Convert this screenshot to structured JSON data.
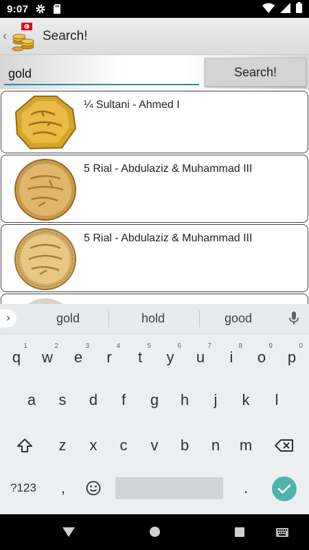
{
  "status_bar": {
    "time": "9:07",
    "icons": [
      "gear-icon",
      "sd-card-icon",
      "wifi-icon",
      "signal-icon",
      "battery-icon"
    ]
  },
  "action_bar": {
    "title": "Search!",
    "flag_color": "#e70013"
  },
  "search": {
    "query": "gold",
    "button_label": "Search!"
  },
  "results": [
    {
      "title": "¼ Sultani - Ahmed I",
      "coin": "octagonal"
    },
    {
      "title": "5 Rial - Abdulaziz & Muhammad III",
      "coin": "round"
    },
    {
      "title": "5 Rial - Abdulaziz & Muhammad III",
      "coin": "round"
    },
    {
      "title": "",
      "coin": "round-partial"
    }
  ],
  "keyboard": {
    "suggestions": [
      "gold",
      "hold",
      "good"
    ],
    "row1": [
      {
        "k": "q",
        "h": "1"
      },
      {
        "k": "w",
        "h": "2"
      },
      {
        "k": "e",
        "h": "3"
      },
      {
        "k": "r",
        "h": "4"
      },
      {
        "k": "t",
        "h": "5"
      },
      {
        "k": "y",
        "h": "6"
      },
      {
        "k": "u",
        "h": "7"
      },
      {
        "k": "i",
        "h": "8"
      },
      {
        "k": "o",
        "h": "9"
      },
      {
        "k": "p",
        "h": "0"
      }
    ],
    "row2": [
      "a",
      "s",
      "d",
      "f",
      "g",
      "h",
      "j",
      "k",
      "l"
    ],
    "row3": [
      "z",
      "x",
      "c",
      "v",
      "b",
      "n",
      "m"
    ],
    "symbols_label": "?123",
    "comma": ",",
    "period": ".",
    "accent": "#4db6ac"
  }
}
